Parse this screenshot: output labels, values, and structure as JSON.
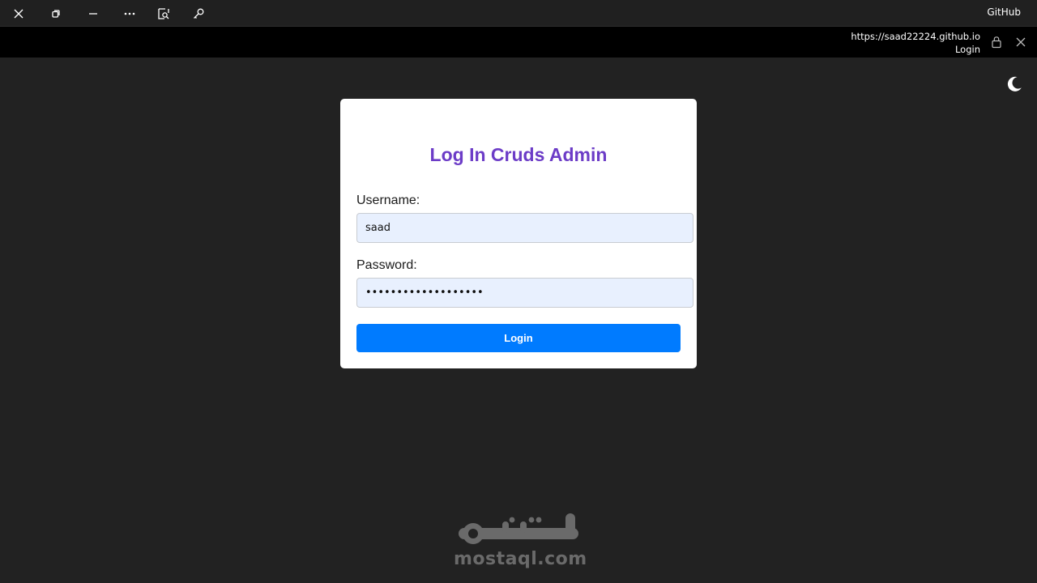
{
  "window": {
    "github_label": "GitHub",
    "icons": [
      "close-icon",
      "restore-icon",
      "minimize-icon",
      "more-icon",
      "find-in-page-icon",
      "key-icon"
    ]
  },
  "urlbar": {
    "url": "https://saad22224.github.io",
    "page_title": "Login"
  },
  "theme_toggle": {
    "icon": "moon-icon"
  },
  "login": {
    "title": "Log In Cruds Admin",
    "username_label": "Username:",
    "username_value": "saad",
    "password_label": "Password:",
    "password_value": "•••••••••••••••••••",
    "button_label": "Login"
  },
  "watermark": {
    "logo_text": "مستقل",
    "domain": "mostaql.com"
  },
  "colors": {
    "background": "#222222",
    "titlebar": "#202020",
    "urlbar": "#000000",
    "title_purple": "#6c3cc7",
    "input_bg": "#e8f0fe",
    "button_blue": "#007bff"
  }
}
